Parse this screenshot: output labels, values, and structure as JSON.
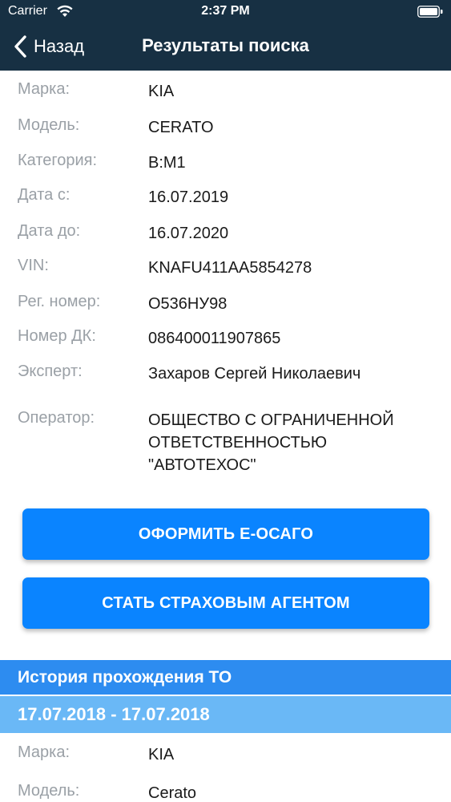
{
  "status_bar": {
    "carrier": "Carrier",
    "time": "2:37 PM"
  },
  "nav": {
    "back_label": "Назад",
    "title": "Результаты поиска"
  },
  "details": [
    {
      "label": "Марка:",
      "value": "KIA"
    },
    {
      "label": "Модель:",
      "value": "CERATO"
    },
    {
      "label": "Категория:",
      "value": "B:M1"
    },
    {
      "label": "Дата с:",
      "value": "16.07.2019"
    },
    {
      "label": "Дата до:",
      "value": "16.07.2020"
    },
    {
      "label": "VIN:",
      "value": "KNAFU411AA5854278"
    },
    {
      "label": "Рег. номер:",
      "value": "О536НУ98"
    },
    {
      "label": "Номер ДК:",
      "value": "086400011907865"
    },
    {
      "label": "Эксперт:",
      "value": "Захаров Сергей Николаевич"
    },
    {
      "label": "Оператор:",
      "value": "ОБЩЕСТВО С ОГРАНИЧЕННОЙ ОТВЕТСТВЕННОСТЬЮ \"АВТОТЕХОС\""
    }
  ],
  "buttons": {
    "eosago": "ОФОРМИТЬ Е-ОСАГО",
    "agent": "СТАТЬ СТРАХОВЫМ АГЕНТОМ"
  },
  "history": {
    "title": "История прохождения ТО",
    "period": "17.07.2018 - 17.07.2018",
    "rows": [
      {
        "label": "Марка:",
        "value": "KIA"
      },
      {
        "label": "Модель:",
        "value": "Cerato"
      }
    ]
  },
  "colors": {
    "header_bg": "#173043",
    "button": "#0a84ff",
    "section": "#2d8cf0",
    "date_bar": "#6ab8f6"
  },
  "icons": [
    "wifi-icon",
    "battery-icon",
    "chevron-left-icon"
  ]
}
